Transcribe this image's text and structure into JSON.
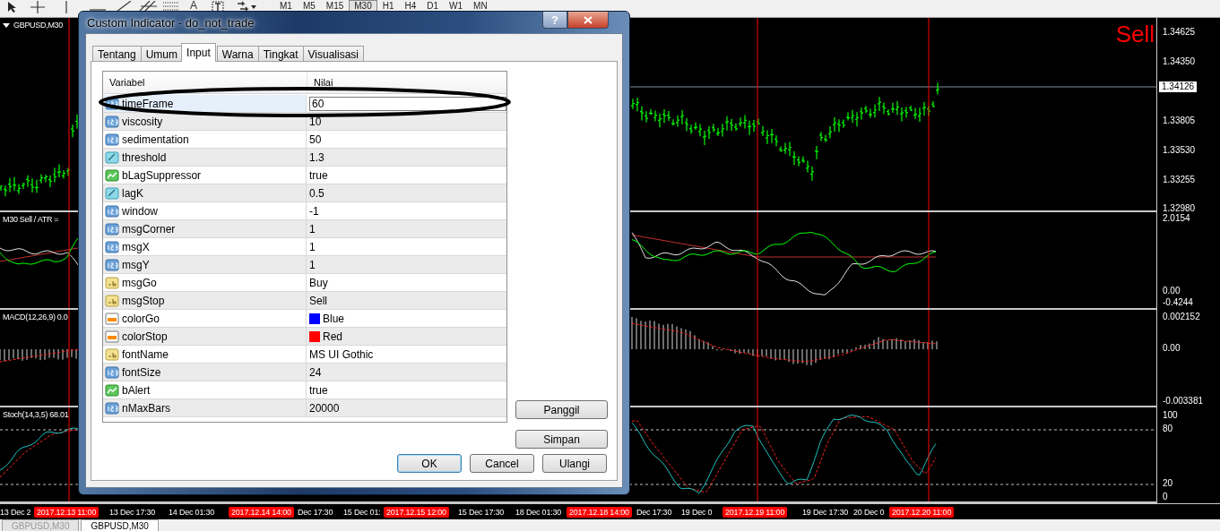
{
  "toolbar": {
    "text_tool": "A",
    "timeframes": [
      {
        "label": "M1",
        "selected": false
      },
      {
        "label": "M5",
        "selected": false
      },
      {
        "label": "M15",
        "selected": false
      },
      {
        "label": "M30",
        "selected": true
      },
      {
        "label": "H1",
        "selected": false
      },
      {
        "label": "H4",
        "selected": false
      },
      {
        "label": "D1",
        "selected": false
      },
      {
        "label": "W1",
        "selected": false
      },
      {
        "label": "MN",
        "selected": false
      }
    ]
  },
  "chart": {
    "signal_text": "Sell",
    "current_price": "1.34126",
    "panes": [
      {
        "kind": "price",
        "label": "GBPUSD,M30",
        "axis_labels": [
          "1.34625",
          "1.34350",
          "1.33805",
          "1.33530",
          "1.33255",
          "1.32980"
        ]
      },
      {
        "kind": "oscillator",
        "label": "M30 Sell  /  ATR =",
        "axis_labels": [
          "2.0154",
          "0.00",
          "-0.4244"
        ]
      },
      {
        "kind": "macd",
        "label": "MACD(12,26,9) 0.0",
        "axis_labels": [
          "0.002152",
          "0.00",
          "-0.003381"
        ]
      },
      {
        "kind": "stochastic",
        "label": "Stoch(14,3,5) 68.01",
        "axis_labels": [
          "100",
          "80",
          "20",
          "0"
        ]
      }
    ],
    "time_axis": [
      {
        "text": "13 Dec 2",
        "marked": false
      },
      {
        "text": "2017.12.13 11:00",
        "marked": true
      },
      {
        "text": "13 Dec 17:30",
        "marked": false
      },
      {
        "text": "14 Dec 01:30",
        "marked": false
      },
      {
        "text": "2017.12.14 14:00",
        "marked": true
      },
      {
        "text": "Dec 17:30",
        "marked": false
      },
      {
        "text": "15 Dec 01:",
        "marked": false
      },
      {
        "text": "2017.12.15 12:00",
        "marked": true
      },
      {
        "text": "15 Dec 17:30",
        "marked": false
      },
      {
        "text": "18 Dec 01:30",
        "marked": false
      },
      {
        "text": "2017.12.18 14:00",
        "marked": true
      },
      {
        "text": "Dec 17:30",
        "marked": false
      },
      {
        "text": "19 Dec 0",
        "marked": false
      },
      {
        "text": "2017.12.19 11:00",
        "marked": true
      },
      {
        "text": "19 Dec 17:30",
        "marked": false
      },
      {
        "text": "20 Dec 0",
        "marked": false
      },
      {
        "text": "2017.12.20 11:00",
        "marked": true
      }
    ]
  },
  "chart_tabs": [
    {
      "label": "GBPUSD,M30",
      "selected": false
    },
    {
      "label": "GBPUSD,M30",
      "selected": true
    }
  ],
  "dialog": {
    "title": "Custom Indicator - do_not_trade",
    "help_button": "?",
    "tabs": [
      {
        "label": "Tentang",
        "selected": false
      },
      {
        "label": "Umum",
        "selected": false
      },
      {
        "label": "Input",
        "selected": true
      },
      {
        "label": "Warna",
        "selected": false
      },
      {
        "label": "Tingkat",
        "selected": false
      },
      {
        "label": "Visualisasi",
        "selected": false
      }
    ],
    "columns": [
      "Variabel",
      "Nilai"
    ],
    "rows": [
      {
        "kind": "int",
        "name": "timeFrame",
        "value": "60",
        "selected": true
      },
      {
        "kind": "int",
        "name": "viscosity",
        "value": "10",
        "selected": false
      },
      {
        "kind": "int",
        "name": "sedimentation",
        "value": "50",
        "selected": false
      },
      {
        "kind": "double",
        "name": "threshold",
        "value": "1.3",
        "selected": false
      },
      {
        "kind": "bool",
        "name": "bLagSuppressor",
        "value": "true",
        "selected": false
      },
      {
        "kind": "double",
        "name": "lagK",
        "value": "0.5",
        "selected": false
      },
      {
        "kind": "int",
        "name": "window",
        "value": "-1",
        "selected": false
      },
      {
        "kind": "int",
        "name": "msgCorner",
        "value": "1",
        "selected": false
      },
      {
        "kind": "int",
        "name": "msgX",
        "value": "1",
        "selected": false
      },
      {
        "kind": "int",
        "name": "msgY",
        "value": "1",
        "selected": false
      },
      {
        "kind": "string",
        "name": "msgGo",
        "value": "Buy",
        "selected": false
      },
      {
        "kind": "string",
        "name": "msgStop",
        "value": "Sell",
        "selected": false
      },
      {
        "kind": "color",
        "name": "colorGo",
        "value": "Blue",
        "color": "#0000ff",
        "selected": false
      },
      {
        "kind": "color",
        "name": "colorStop",
        "value": "Red",
        "color": "#ff0000",
        "selected": false
      },
      {
        "kind": "string",
        "name": "fontName",
        "value": "MS UI Gothic",
        "selected": false
      },
      {
        "kind": "int",
        "name": "fontSize",
        "value": "24",
        "selected": false
      },
      {
        "kind": "bool",
        "name": "bAlert",
        "value": "true",
        "selected": false
      },
      {
        "kind": "int",
        "name": "nMaxBars",
        "value": "20000",
        "selected": false
      }
    ],
    "side_buttons": [
      "Panggil",
      "Simpan"
    ],
    "buttons": [
      "OK",
      "Cancel",
      "Ulangi"
    ]
  }
}
